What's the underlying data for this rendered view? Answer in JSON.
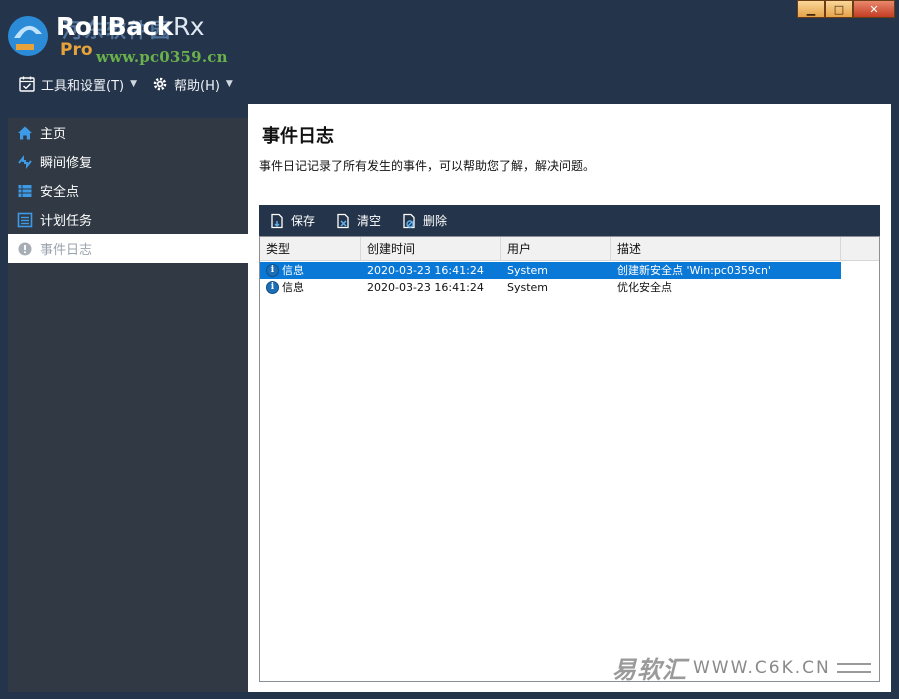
{
  "app": {
    "title_main": "RollBack",
    "title_rx": "Rx",
    "title_edition": "Pro",
    "watermark_cn": "河东软件园",
    "watermark_url": "www.pc0359.cn"
  },
  "window_controls": {
    "minimize": "▁",
    "maximize": "□",
    "close": "✕"
  },
  "menu": {
    "tools": "工具和设置(T)",
    "help": "帮助(H)"
  },
  "sidebar": {
    "items": [
      {
        "label": "主页",
        "icon": "home-icon"
      },
      {
        "label": "瞬间修复",
        "icon": "instant-restore-icon"
      },
      {
        "label": "安全点",
        "icon": "snapshot-icon"
      },
      {
        "label": "计划任务",
        "icon": "schedule-icon"
      },
      {
        "label": "事件日志",
        "icon": "event-log-icon",
        "active": true
      }
    ]
  },
  "main": {
    "title": "事件日志",
    "description": "事件日记记录了所有发生的事件，可以帮助您了解，解决问题。",
    "toolbar": {
      "save": "保存",
      "clear": "清空",
      "delete": "删除"
    },
    "columns": [
      "类型",
      "创建时间",
      "用户",
      "描述"
    ],
    "rows": [
      {
        "type": "信息",
        "time": "2020-03-23 16:41:24",
        "user": "System",
        "desc": "创建新安全点 'Win:pc0359cn'",
        "selected": true
      },
      {
        "type": "信息",
        "time": "2020-03-23 16:41:24",
        "user": "System",
        "desc": "优化安全点",
        "selected": false
      }
    ]
  },
  "footer_watermark": {
    "cn": "易软汇",
    "url": "WWW.C6K.CN"
  },
  "colors": {
    "frame": "#24344a",
    "sidebar": "#313a44",
    "selection": "#0a78d7",
    "accent_orange": "#e8a23a"
  }
}
